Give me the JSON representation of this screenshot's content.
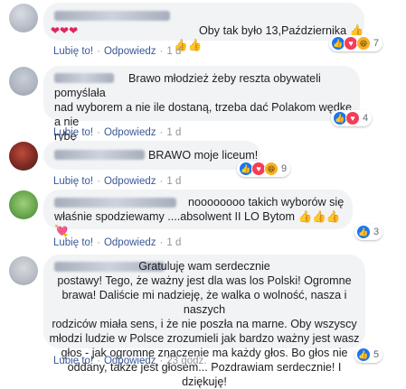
{
  "comments": [
    {
      "text": "Oby tak było 13,Października 👍👍👍",
      "hearts": "❤❤❤",
      "like": "Lubię to!",
      "reply": "Odpowiedz",
      "time": "1 d",
      "reactions": {
        "icons": [
          "like-icon",
          "love-icon",
          "haha-icon"
        ],
        "count": "7"
      }
    },
    {
      "text": "Brawo młodzież żeby reszta obywateli pomyślała\nnad wyborem a nie ile dostaną, trzeba dać Polakom wędkę a nie\nrybę",
      "like": "Lubię to!",
      "reply": "Odpowiedz",
      "time": "1 d",
      "reactions": {
        "icons": [
          "like-icon",
          "love-icon"
        ],
        "count": "4"
      }
    },
    {
      "text": "BRAWO moje liceum!",
      "like": "Lubię to!",
      "reply": "Odpowiedz",
      "time": "1 d",
      "reactions": {
        "icons": [
          "like-icon",
          "love-icon",
          "haha-icon"
        ],
        "count": "9"
      }
    },
    {
      "text": "noooooooo takich wyborów się\nwłaśnie spodziewamy ....absolwent II LO Bytom 👍👍👍💘",
      "like": "Lubię to!",
      "reply": "Odpowiedz",
      "time": "1 d",
      "reactions": {
        "icons": [
          "like-icon"
        ],
        "count": "3"
      }
    },
    {
      "text": "Gratuluję wam serdecznie\npostawy! Tego, że ważny jest dla was los Polski! Ogromne\nbrawa! Daliście mi nadzieję, że walka o wolność, nasza i naszych\nrodziców miała sens, i że nie poszła na marne. Oby wszyscy\nmłodzi ludzie w Polsce zrozumieli jak bardzo ważny jest wasz\ngłos - jak ogromne znaczenie ma każdy głos. Bo głos nie\noddany, także jest głosem... Pozdrawiam serdecznie! I dziękuję!",
      "like": "Lubię to!",
      "reply": "Odpowiedz",
      "time": "23 godz.",
      "reactions": {
        "icons": [
          "like-icon"
        ],
        "count": "5"
      }
    }
  ],
  "colors": {
    "link": "#385898",
    "bubble": "#f2f3f5",
    "like": "#1877f2",
    "love": "#f33e58",
    "haha": "#f7b125"
  }
}
